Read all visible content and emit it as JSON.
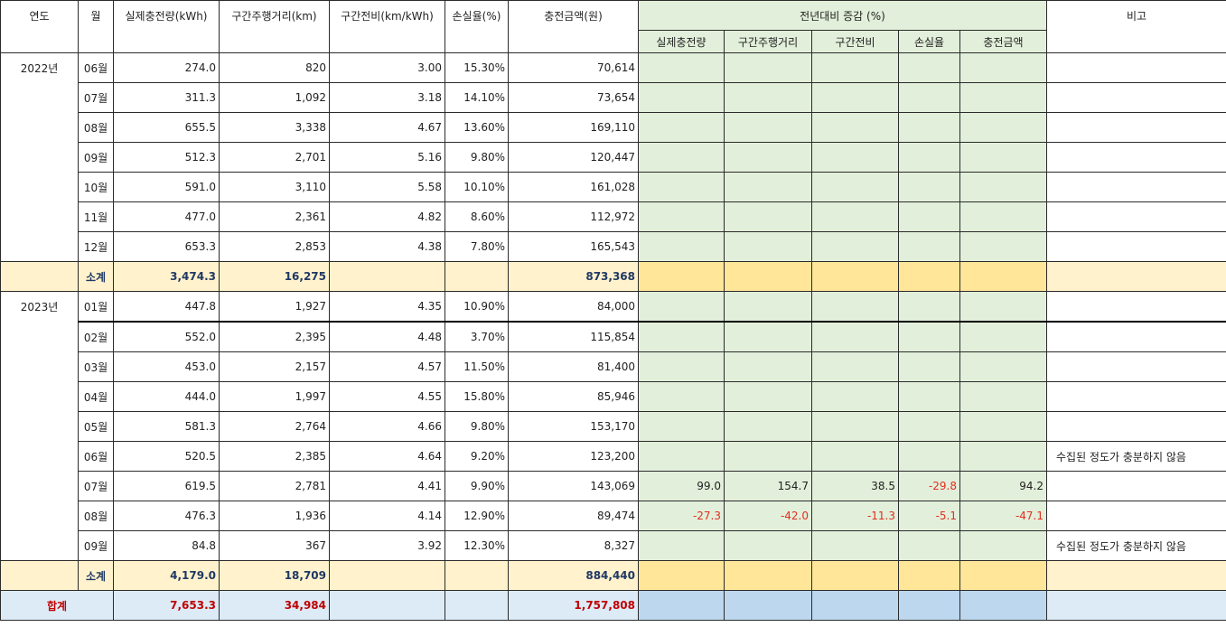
{
  "headers": {
    "year": "연도",
    "month": "월",
    "charge": "실제충전량(kWh)",
    "distance": "구간주행거리(km)",
    "efficiency": "구간전비(km/kWh)",
    "loss": "손실율(%)",
    "amount": "충전금액(원)",
    "yoy_group": "전년대비 증감 (%)",
    "note": "비고",
    "yoy": [
      "실제충전량",
      "구간주행거리",
      "구간전비",
      "손실율",
      "충전금액"
    ]
  },
  "years": [
    {
      "label": "2022년",
      "rows": [
        {
          "month": "06월",
          "charge": "274.0",
          "distance": "820",
          "efficiency": "3.00",
          "loss": "15.30%",
          "amount": "70,614",
          "yoy": [
            "",
            "",
            "",
            "",
            ""
          ],
          "note": ""
        },
        {
          "month": "07월",
          "charge": "311.3",
          "distance": "1,092",
          "efficiency": "3.18",
          "loss": "14.10%",
          "amount": "73,654",
          "yoy": [
            "",
            "",
            "",
            "",
            ""
          ],
          "note": ""
        },
        {
          "month": "08월",
          "charge": "655.5",
          "distance": "3,338",
          "efficiency": "4.67",
          "loss": "13.60%",
          "amount": "169,110",
          "yoy": [
            "",
            "",
            "",
            "",
            ""
          ],
          "note": ""
        },
        {
          "month": "09월",
          "charge": "512.3",
          "distance": "2,701",
          "efficiency": "5.16",
          "loss": "9.80%",
          "amount": "120,447",
          "yoy": [
            "",
            "",
            "",
            "",
            ""
          ],
          "note": ""
        },
        {
          "month": "10월",
          "charge": "591.0",
          "distance": "3,110",
          "efficiency": "5.58",
          "loss": "10.10%",
          "amount": "161,028",
          "yoy": [
            "",
            "",
            "",
            "",
            ""
          ],
          "note": ""
        },
        {
          "month": "11월",
          "charge": "477.0",
          "distance": "2,361",
          "efficiency": "4.82",
          "loss": "8.60%",
          "amount": "112,972",
          "yoy": [
            "",
            "",
            "",
            "",
            ""
          ],
          "note": ""
        },
        {
          "month": "12월",
          "charge": "653.3",
          "distance": "2,853",
          "efficiency": "4.38",
          "loss": "7.80%",
          "amount": "165,543",
          "yoy": [
            "",
            "",
            "",
            "",
            ""
          ],
          "note": ""
        }
      ],
      "subtotal": {
        "label": "소계",
        "charge": "3,474.3",
        "distance": "16,275",
        "amount": "873,368"
      }
    },
    {
      "label": "2023년",
      "rows": [
        {
          "month": "01월",
          "charge": "447.8",
          "distance": "1,927",
          "efficiency": "4.35",
          "loss": "10.90%",
          "amount": "84,000",
          "yoy": [
            "",
            "",
            "",
            "",
            ""
          ],
          "note": ""
        },
        {
          "month": "02월",
          "charge": "552.0",
          "distance": "2,395",
          "efficiency": "4.48",
          "loss": "3.70%",
          "amount": "115,854",
          "yoy": [
            "",
            "",
            "",
            "",
            ""
          ],
          "note": ""
        },
        {
          "month": "03월",
          "charge": "453.0",
          "distance": "2,157",
          "efficiency": "4.57",
          "loss": "11.50%",
          "amount": "81,400",
          "yoy": [
            "",
            "",
            "",
            "",
            ""
          ],
          "note": ""
        },
        {
          "month": "04월",
          "charge": "444.0",
          "distance": "1,997",
          "efficiency": "4.55",
          "loss": "15.80%",
          "amount": "85,946",
          "yoy": [
            "",
            "",
            "",
            "",
            ""
          ],
          "note": ""
        },
        {
          "month": "05월",
          "charge": "581.3",
          "distance": "2,764",
          "efficiency": "4.66",
          "loss": "9.80%",
          "amount": "153,170",
          "yoy": [
            "",
            "",
            "",
            "",
            ""
          ],
          "note": ""
        },
        {
          "month": "06월",
          "charge": "520.5",
          "distance": "2,385",
          "efficiency": "4.64",
          "loss": "9.20%",
          "amount": "123,200",
          "yoy": [
            "",
            "",
            "",
            "",
            ""
          ],
          "note": "수집된 정도가 충분하지 않음"
        },
        {
          "month": "07월",
          "charge": "619.5",
          "distance": "2,781",
          "efficiency": "4.41",
          "loss": "9.90%",
          "amount": "143,069",
          "yoy": [
            "99.0",
            "154.7",
            "38.5",
            "-29.8",
            "94.2"
          ],
          "note": ""
        },
        {
          "month": "08월",
          "charge": "476.3",
          "distance": "1,936",
          "efficiency": "4.14",
          "loss": "12.90%",
          "amount": "89,474",
          "yoy": [
            "-27.3",
            "-42.0",
            "-11.3",
            "-5.1",
            "-47.1"
          ],
          "note": ""
        },
        {
          "month": "09월",
          "charge": "84.8",
          "distance": "367",
          "efficiency": "3.92",
          "loss": "12.30%",
          "amount": "8,327",
          "yoy": [
            "",
            "",
            "",
            "",
            ""
          ],
          "note": "수집된 정도가 충분하지 않음"
        }
      ],
      "subtotal": {
        "label": "소계",
        "charge": "4,179.0",
        "distance": "18,709",
        "amount": "884,440"
      }
    }
  ],
  "total": {
    "label": "합계",
    "charge": "7,653.3",
    "distance": "34,984",
    "amount": "1,757,808"
  },
  "colors": {
    "green": "#e2efda",
    "subtotal": "#fff2cc",
    "subtotal_yoy": "#ffe699",
    "total": "#ddebf7",
    "total_yoy": "#bdd7ee",
    "negative": "#e03020",
    "total_text": "#c00000"
  }
}
